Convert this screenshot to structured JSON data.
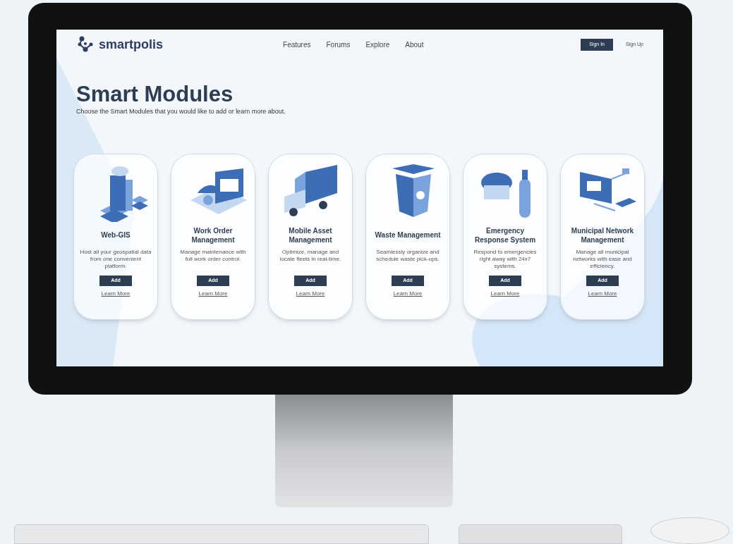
{
  "logo": {
    "text": "smartpolis"
  },
  "nav": {
    "links": [
      "Features",
      "Forums",
      "Explore",
      "About"
    ],
    "sign_in": "Sign In",
    "sign_up": "Sign Up"
  },
  "header": {
    "title": "Smart Modules",
    "subtitle": "Choose the Smart Modules that you would like to add or learn more about."
  },
  "modules": [
    {
      "title": "Web-GIS",
      "description": "Host all your geospatial data from one convenient platform.",
      "button": "Add",
      "link": "Learn More"
    },
    {
      "title": "Work Order Management",
      "description": "Manage maintenance with full work order control.",
      "button": "Add",
      "link": "Learn More"
    },
    {
      "title": "Mobile Asset Management",
      "description": "Optimize, manage and locate fleets in real-time.",
      "button": "Add",
      "link": "Learn More"
    },
    {
      "title": "Waste Management",
      "description": "Seamlessly organize and schedule waste pick-ups.",
      "button": "Add",
      "link": "Learn More"
    },
    {
      "title": "Emergency Response System",
      "description": "Respond to emergencies right away with 24x7 systems.",
      "button": "Add",
      "link": "Learn More"
    },
    {
      "title": "Municipal Network Management",
      "description": "Manage all municipal networks with ease and efficiency.",
      "button": "Add",
      "link": "Learn More"
    }
  ]
}
